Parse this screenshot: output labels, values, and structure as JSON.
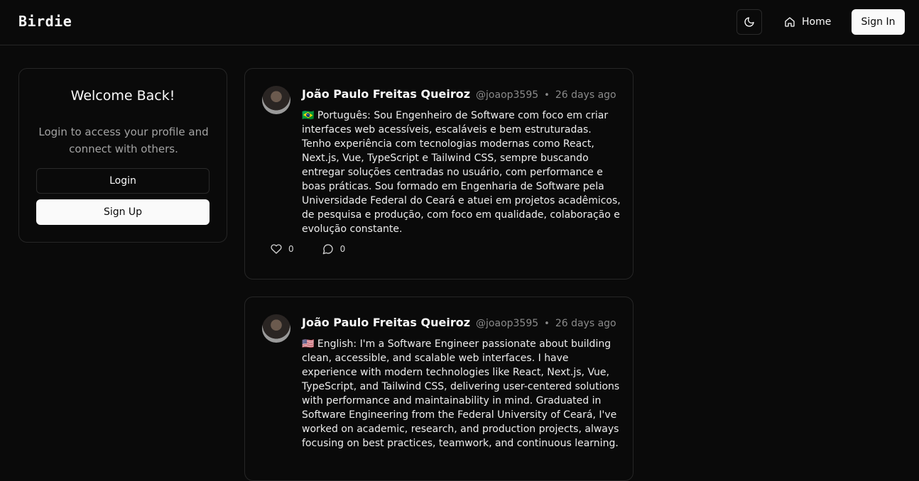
{
  "header": {
    "brand": "Birdie",
    "home_label": "Home",
    "signin_label": "Sign In"
  },
  "welcome": {
    "title": "Welcome Back!",
    "subtitle": "Login to access your profile and connect with others.",
    "login_label": "Login",
    "signup_label": "Sign Up"
  },
  "posts": [
    {
      "author": "João Paulo Freitas Queiroz",
      "handle": "@joaop3595",
      "separator": "•",
      "time": "26 days ago",
      "body": "🇧🇷 Português: Sou Engenheiro de Software com foco em criar interfaces web acessíveis, escaláveis e bem estruturadas. Tenho experiência com tecnologias modernas como React, Next.js, Vue, TypeScript e Tailwind CSS, sempre buscando entregar soluções centradas no usuário, com performance e boas práticas. Sou formado em Engenharia de Software pela Universidade Federal do Ceará e atuei em projetos acadêmicos, de pesquisa e produção, com foco em qualidade, colaboração e evolução constante.",
      "likes": "0",
      "comments": "0"
    },
    {
      "author": "João Paulo Freitas Queiroz",
      "handle": "@joaop3595",
      "separator": "•",
      "time": "26 days ago",
      "body": "🇺🇸 English: I'm a Software Engineer passionate about building clean, accessible, and scalable web interfaces. I have experience with modern technologies like React, Next.js, Vue, TypeScript, and Tailwind CSS, delivering user-centered solutions with performance and maintainability in mind. Graduated in Software Engineering from the Federal University of Ceará, I've worked on academic, research, and production projects, always focusing on best practices, teamwork, and continuous learning."
    }
  ],
  "icons": {
    "theme": "moon-icon",
    "home": "home-icon",
    "like": "heart-icon",
    "comment": "comment-icon"
  }
}
